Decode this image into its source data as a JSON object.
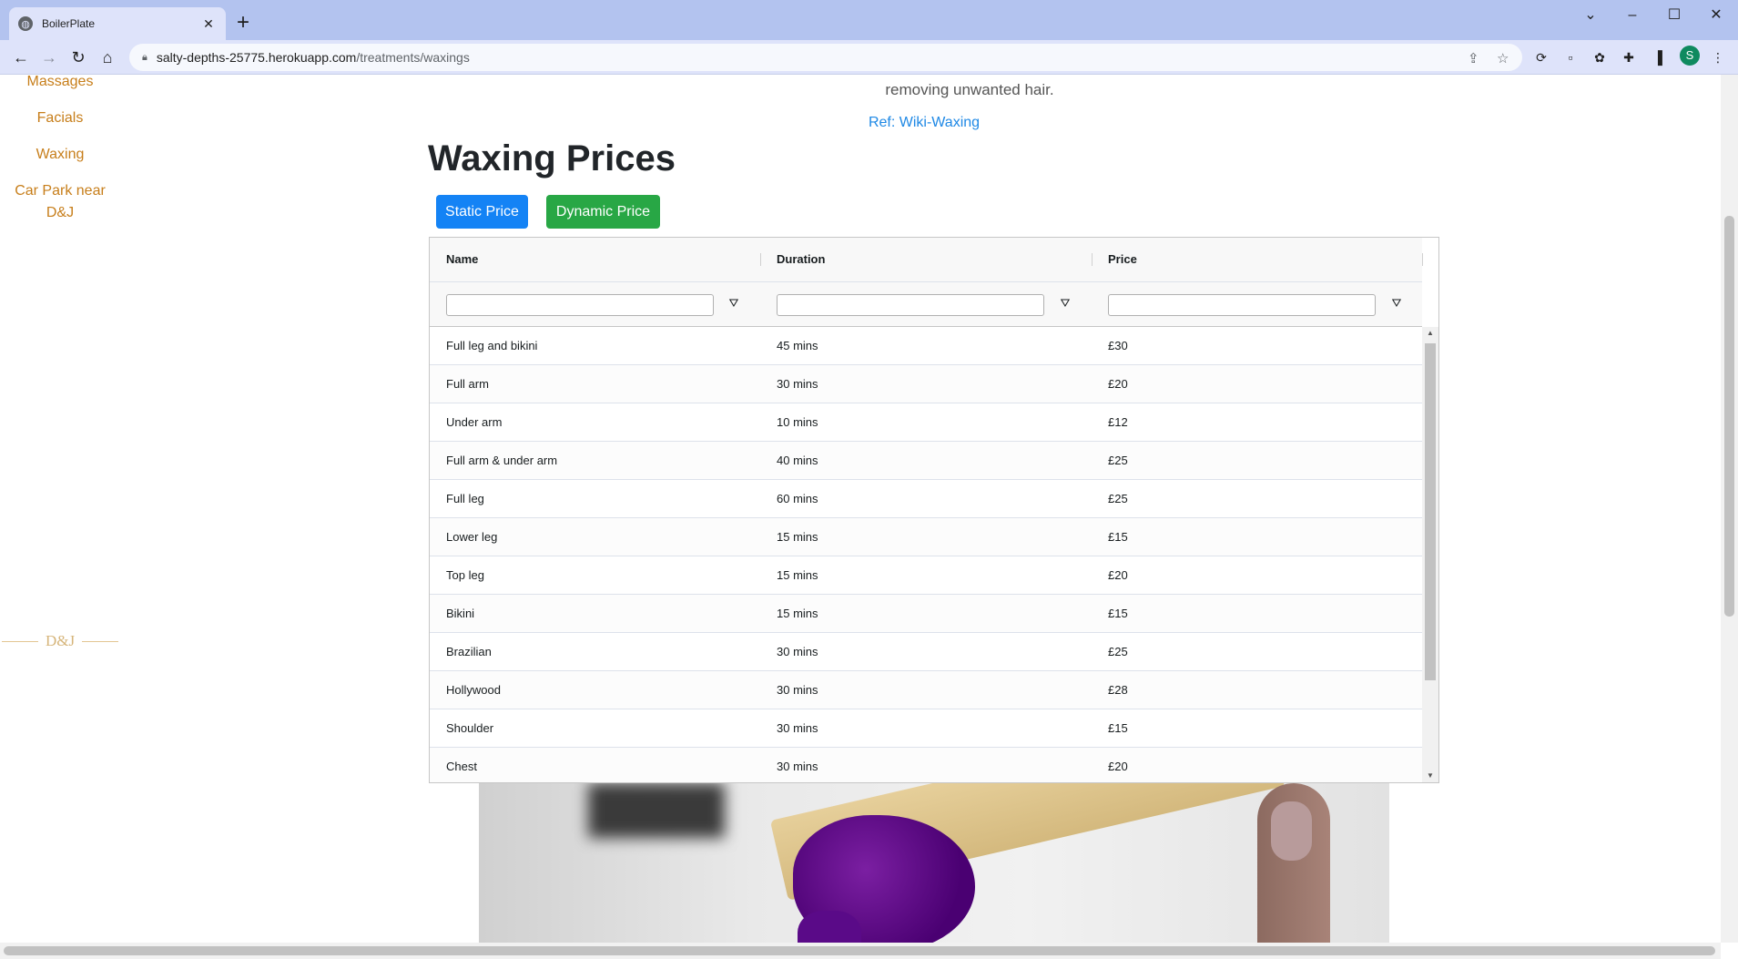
{
  "browser": {
    "tab_title": "BoilerPlate",
    "url_host": "salty-depths-25775.herokuapp.com",
    "url_path": "/treatments/waxings",
    "profile_initial": "S"
  },
  "sidebar": {
    "items": [
      {
        "label": "Massages"
      },
      {
        "label": "Facials"
      },
      {
        "label": "Waxing"
      },
      {
        "label": "Car Park near"
      },
      {
        "label": "D&J"
      }
    ],
    "logo_text": "D&J"
  },
  "content": {
    "intro_tail": "removing unwanted hair.",
    "ref_link": "Ref: Wiki-Waxing",
    "title": "Waxing Prices",
    "buttons": {
      "static": "Static Price",
      "dynamic": "Dynamic Price"
    }
  },
  "grid": {
    "columns": [
      "Name",
      "Duration",
      "Price"
    ],
    "rows": [
      [
        "Full leg and bikini",
        "45 mins",
        "£30"
      ],
      [
        "Full arm",
        "30 mins",
        "£20"
      ],
      [
        "Under arm",
        "10 mins",
        "£12"
      ],
      [
        "Full arm & under arm",
        "40 mins",
        "£25"
      ],
      [
        "Full leg",
        "60 mins",
        "£25"
      ],
      [
        "Lower leg",
        "15 mins",
        "£15"
      ],
      [
        "Top leg",
        "15 mins",
        "£20"
      ],
      [
        "Bikini",
        "15 mins",
        "£15"
      ],
      [
        "Brazilian",
        "30 mins",
        "£25"
      ],
      [
        "Hollywood",
        "30 mins",
        "£28"
      ],
      [
        "Shoulder",
        "30 mins",
        "£15"
      ],
      [
        "Chest",
        "30 mins",
        "£20"
      ]
    ]
  },
  "colors": {
    "sidebar_link": "#c77e1a",
    "static_button": "#1483f5",
    "dynamic_button": "#28a745",
    "link": "#1e88e5"
  }
}
